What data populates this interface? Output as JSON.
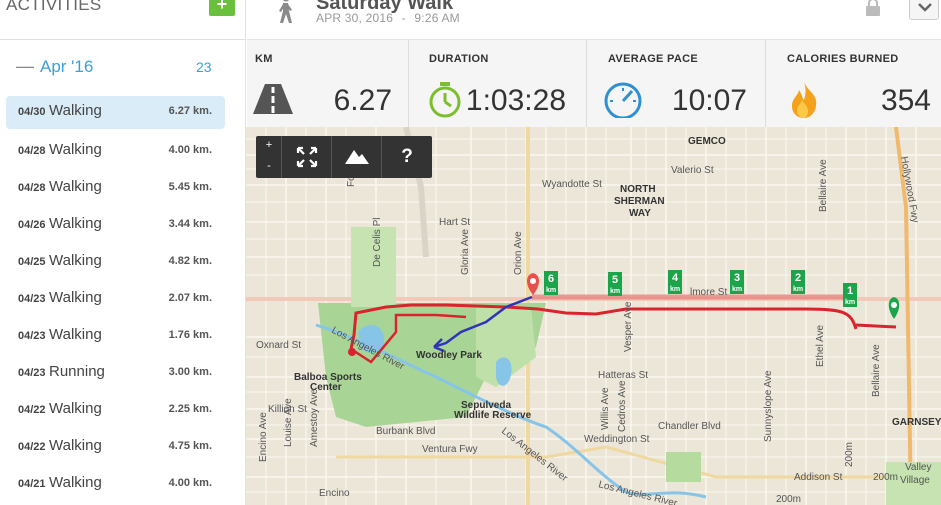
{
  "sidebar": {
    "title": "ACTIVITIES",
    "add_label": "+",
    "month": {
      "label": "Apr '16",
      "count": "23"
    },
    "activities": [
      {
        "date": "04/30",
        "type": "Walking",
        "distance": "6.27 km."
      },
      {
        "date": "04/28",
        "type": "Walking",
        "distance": "4.00 km."
      },
      {
        "date": "04/28",
        "type": "Walking",
        "distance": "5.45 km."
      },
      {
        "date": "04/26",
        "type": "Walking",
        "distance": "3.44 km."
      },
      {
        "date": "04/25",
        "type": "Walking",
        "distance": "4.82 km."
      },
      {
        "date": "04/23",
        "type": "Walking",
        "distance": "2.07 km."
      },
      {
        "date": "04/23",
        "type": "Walking",
        "distance": "1.76 km."
      },
      {
        "date": "04/23",
        "type": "Running",
        "distance": "3.00 km."
      },
      {
        "date": "04/22",
        "type": "Walking",
        "distance": "2.25 km."
      },
      {
        "date": "04/22",
        "type": "Walking",
        "distance": "4.75 km."
      },
      {
        "date": "04/21",
        "type": "Walking",
        "distance": "4.00 km."
      }
    ]
  },
  "header": {
    "title": "Saturday Walk",
    "date": "APR 30, 2016",
    "separator": "-",
    "time": "9:26 AM"
  },
  "stats": {
    "km": {
      "label": "KM",
      "value": "6.27"
    },
    "duration": {
      "label": "DURATION",
      "value": "1:03:28"
    },
    "pace": {
      "label": "AVERAGE PACE",
      "value": "10:07"
    },
    "calories": {
      "label": "CALORIES BURNED",
      "value": "354"
    }
  },
  "map": {
    "controls": {
      "zoom_in": "+",
      "zoom_out": "-",
      "help": "?"
    },
    "km_markers": [
      "1",
      "2",
      "3",
      "4",
      "5",
      "6"
    ],
    "km_unit": "km",
    "labels": {
      "gemco": "GEMCO",
      "north_sherman_way_1": "NORTH",
      "north_sherman_way_2": "SHERMAN",
      "north_sherman_way_3": "WAY",
      "wyandotte": "Wyandotte St",
      "valerio": "Valerio St",
      "hart": "Hart St",
      "elmore": "lmore St",
      "oxnard": "Oxnard St",
      "woodley_park": "Woodley Park",
      "balboa_1": "Balboa Sports",
      "balboa_2": "Center",
      "sepulveda_1": "Sepulveda",
      "sepulveda_2": "Wildlife Reserve",
      "hatteras": "Hatteras St",
      "killion": "Killion St",
      "burbank": "Burbank Blvd",
      "ventura": "Ventura Fwy",
      "chandler": "Chandler Blvd",
      "weddington": "Weddington St",
      "addison": "Addison St",
      "la_river_1": "Los Angeles River",
      "la_river_2": "Los Angeles River",
      "la_river_3": "Los Angeles River",
      "garnsey": "GARNSEY",
      "valley_1": "Valley",
      "valley_2": "Village",
      "encino": "Encino",
      "forbes": "Forbes Ave",
      "de_celis": "De Celis Pl",
      "gloria": "Gloria Ave",
      "orion": "Orion Ave",
      "ethel": "Ethel Ave",
      "bellaire": "Bellaire Ave",
      "bellaire2": "Bellaire Ave",
      "hollywood": "Hollywood Fwy",
      "sunnyslope": "Sunnyslope Ave",
      "encino_ave": "Encino Ave",
      "louise": "Louise Ave",
      "amestoy": "Amestoy Ave",
      "willis": "Willis Ave",
      "cedros": "Cedros Ave",
      "vesper": "Vesper Ave",
      "dist_200m_1": "200m",
      "dist_200m_2": "200m",
      "dist_200m_3": "200m"
    }
  },
  "colors": {
    "accent_blue": "#3a9fd8",
    "add_green": "#6abf3d",
    "route_red": "#d9232d",
    "route_blue": "#3035b8",
    "marker_green": "#1ba44a",
    "park_green": "#a8d596",
    "water_blue": "#86c4e8"
  },
  "icons": {
    "walker": "walker-icon",
    "lock": "lock-icon",
    "menu": "chevron-down-icon",
    "km": "road-icon",
    "duration": "stopwatch-icon",
    "pace": "speedometer-icon",
    "calories": "flame-icon",
    "fullscreen": "fullscreen-icon",
    "terrain": "mountain-icon"
  }
}
